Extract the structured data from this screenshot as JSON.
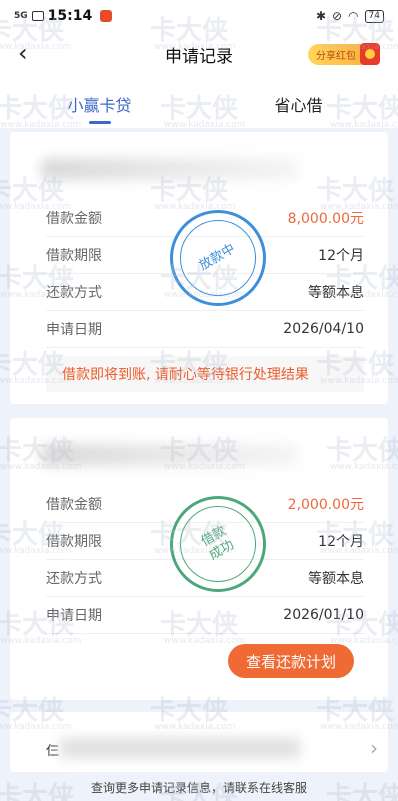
{
  "status": {
    "network": "5G",
    "time": "15:14",
    "battery": "74"
  },
  "nav": {
    "back_glyph": "‹",
    "title": "申请记录",
    "share_label": "分享红包"
  },
  "tabs": [
    {
      "label": "小赢卡贷",
      "active": true
    },
    {
      "label": "省心借",
      "active": false
    }
  ],
  "records": [
    {
      "rows": [
        {
          "label": "借款金额",
          "value": "8,000.00元"
        },
        {
          "label": "借款期限",
          "value": "12个月"
        },
        {
          "label": "还款方式",
          "value": "等额本息"
        },
        {
          "label": "申请日期",
          "value": "2026/04/10"
        }
      ],
      "stamp": "放款中",
      "notice": "借款即将到账, 请耐心等待银行处理结果"
    },
    {
      "rows": [
        {
          "label": "借款金额",
          "value": "2,000.00元"
        },
        {
          "label": "借款期限",
          "value": "12个月"
        },
        {
          "label": "还款方式",
          "value": "等额本息"
        },
        {
          "label": "申请日期",
          "value": "2026/01/10"
        }
      ],
      "stamp": "借款\n成功",
      "button": "查看还款计划"
    }
  ],
  "third_partial": "仨",
  "footer": "查询更多申请记录信息，请联系在线客服",
  "watermark": {
    "brand": "卡大侠",
    "url": "www.kadaxia.com"
  },
  "colors": {
    "accent": "#3f67c9",
    "amount": "#ee6a3a",
    "button": "#ef6a34",
    "stamp_blue": "#3e8fd9",
    "stamp_green": "#4ea77a"
  }
}
